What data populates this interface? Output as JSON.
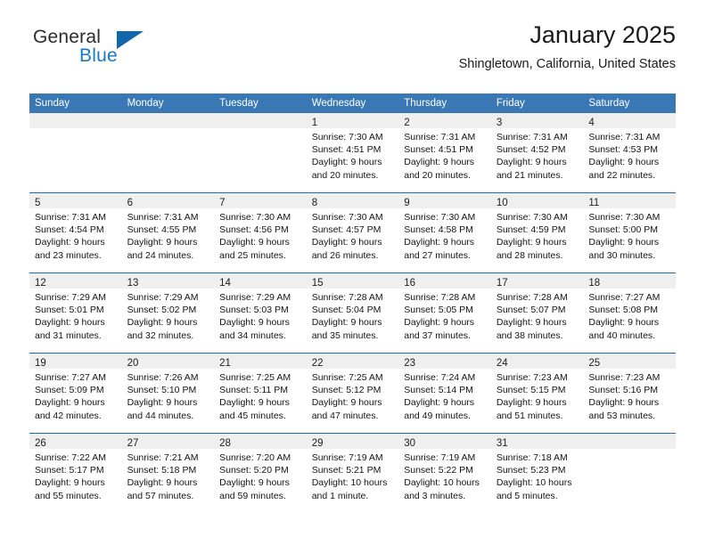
{
  "brand": {
    "name_part1": "General",
    "name_part2": "Blue",
    "accent_color": "#1878c8",
    "flag_color": "#1266ab"
  },
  "header": {
    "title": "January 2025",
    "location": "Shingletown, California, United States"
  },
  "theme": {
    "header_row_bg": "#3a78b5",
    "row_separator": "#1f69ad",
    "date_strip_bg": "#efefef"
  },
  "weekdays": [
    "Sunday",
    "Monday",
    "Tuesday",
    "Wednesday",
    "Thursday",
    "Friday",
    "Saturday"
  ],
  "weeks": [
    [
      {
        "day": "",
        "lines": []
      },
      {
        "day": "",
        "lines": []
      },
      {
        "day": "",
        "lines": []
      },
      {
        "day": "1",
        "lines": [
          "Sunrise: 7:30 AM",
          "Sunset: 4:51 PM",
          "Daylight: 9 hours",
          "and 20 minutes."
        ]
      },
      {
        "day": "2",
        "lines": [
          "Sunrise: 7:31 AM",
          "Sunset: 4:51 PM",
          "Daylight: 9 hours",
          "and 20 minutes."
        ]
      },
      {
        "day": "3",
        "lines": [
          "Sunrise: 7:31 AM",
          "Sunset: 4:52 PM",
          "Daylight: 9 hours",
          "and 21 minutes."
        ]
      },
      {
        "day": "4",
        "lines": [
          "Sunrise: 7:31 AM",
          "Sunset: 4:53 PM",
          "Daylight: 9 hours",
          "and 22 minutes."
        ]
      }
    ],
    [
      {
        "day": "5",
        "lines": [
          "Sunrise: 7:31 AM",
          "Sunset: 4:54 PM",
          "Daylight: 9 hours",
          "and 23 minutes."
        ]
      },
      {
        "day": "6",
        "lines": [
          "Sunrise: 7:31 AM",
          "Sunset: 4:55 PM",
          "Daylight: 9 hours",
          "and 24 minutes."
        ]
      },
      {
        "day": "7",
        "lines": [
          "Sunrise: 7:30 AM",
          "Sunset: 4:56 PM",
          "Daylight: 9 hours",
          "and 25 minutes."
        ]
      },
      {
        "day": "8",
        "lines": [
          "Sunrise: 7:30 AM",
          "Sunset: 4:57 PM",
          "Daylight: 9 hours",
          "and 26 minutes."
        ]
      },
      {
        "day": "9",
        "lines": [
          "Sunrise: 7:30 AM",
          "Sunset: 4:58 PM",
          "Daylight: 9 hours",
          "and 27 minutes."
        ]
      },
      {
        "day": "10",
        "lines": [
          "Sunrise: 7:30 AM",
          "Sunset: 4:59 PM",
          "Daylight: 9 hours",
          "and 28 minutes."
        ]
      },
      {
        "day": "11",
        "lines": [
          "Sunrise: 7:30 AM",
          "Sunset: 5:00 PM",
          "Daylight: 9 hours",
          "and 30 minutes."
        ]
      }
    ],
    [
      {
        "day": "12",
        "lines": [
          "Sunrise: 7:29 AM",
          "Sunset: 5:01 PM",
          "Daylight: 9 hours",
          "and 31 minutes."
        ]
      },
      {
        "day": "13",
        "lines": [
          "Sunrise: 7:29 AM",
          "Sunset: 5:02 PM",
          "Daylight: 9 hours",
          "and 32 minutes."
        ]
      },
      {
        "day": "14",
        "lines": [
          "Sunrise: 7:29 AM",
          "Sunset: 5:03 PM",
          "Daylight: 9 hours",
          "and 34 minutes."
        ]
      },
      {
        "day": "15",
        "lines": [
          "Sunrise: 7:28 AM",
          "Sunset: 5:04 PM",
          "Daylight: 9 hours",
          "and 35 minutes."
        ]
      },
      {
        "day": "16",
        "lines": [
          "Sunrise: 7:28 AM",
          "Sunset: 5:05 PM",
          "Daylight: 9 hours",
          "and 37 minutes."
        ]
      },
      {
        "day": "17",
        "lines": [
          "Sunrise: 7:28 AM",
          "Sunset: 5:07 PM",
          "Daylight: 9 hours",
          "and 38 minutes."
        ]
      },
      {
        "day": "18",
        "lines": [
          "Sunrise: 7:27 AM",
          "Sunset: 5:08 PM",
          "Daylight: 9 hours",
          "and 40 minutes."
        ]
      }
    ],
    [
      {
        "day": "19",
        "lines": [
          "Sunrise: 7:27 AM",
          "Sunset: 5:09 PM",
          "Daylight: 9 hours",
          "and 42 minutes."
        ]
      },
      {
        "day": "20",
        "lines": [
          "Sunrise: 7:26 AM",
          "Sunset: 5:10 PM",
          "Daylight: 9 hours",
          "and 44 minutes."
        ]
      },
      {
        "day": "21",
        "lines": [
          "Sunrise: 7:25 AM",
          "Sunset: 5:11 PM",
          "Daylight: 9 hours",
          "and 45 minutes."
        ]
      },
      {
        "day": "22",
        "lines": [
          "Sunrise: 7:25 AM",
          "Sunset: 5:12 PM",
          "Daylight: 9 hours",
          "and 47 minutes."
        ]
      },
      {
        "day": "23",
        "lines": [
          "Sunrise: 7:24 AM",
          "Sunset: 5:14 PM",
          "Daylight: 9 hours",
          "and 49 minutes."
        ]
      },
      {
        "day": "24",
        "lines": [
          "Sunrise: 7:23 AM",
          "Sunset: 5:15 PM",
          "Daylight: 9 hours",
          "and 51 minutes."
        ]
      },
      {
        "day": "25",
        "lines": [
          "Sunrise: 7:23 AM",
          "Sunset: 5:16 PM",
          "Daylight: 9 hours",
          "and 53 minutes."
        ]
      }
    ],
    [
      {
        "day": "26",
        "lines": [
          "Sunrise: 7:22 AM",
          "Sunset: 5:17 PM",
          "Daylight: 9 hours",
          "and 55 minutes."
        ]
      },
      {
        "day": "27",
        "lines": [
          "Sunrise: 7:21 AM",
          "Sunset: 5:18 PM",
          "Daylight: 9 hours",
          "and 57 minutes."
        ]
      },
      {
        "day": "28",
        "lines": [
          "Sunrise: 7:20 AM",
          "Sunset: 5:20 PM",
          "Daylight: 9 hours",
          "and 59 minutes."
        ]
      },
      {
        "day": "29",
        "lines": [
          "Sunrise: 7:19 AM",
          "Sunset: 5:21 PM",
          "Daylight: 10 hours",
          "and 1 minute."
        ]
      },
      {
        "day": "30",
        "lines": [
          "Sunrise: 7:19 AM",
          "Sunset: 5:22 PM",
          "Daylight: 10 hours",
          "and 3 minutes."
        ]
      },
      {
        "day": "31",
        "lines": [
          "Sunrise: 7:18 AM",
          "Sunset: 5:23 PM",
          "Daylight: 10 hours",
          "and 5 minutes."
        ]
      },
      {
        "day": "",
        "lines": []
      }
    ]
  ]
}
